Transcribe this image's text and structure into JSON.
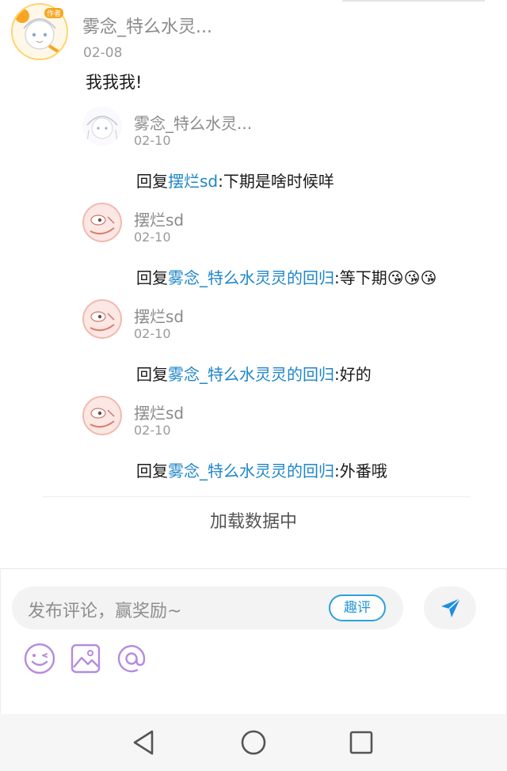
{
  "thread": {
    "main_comment": {
      "author": "雾念_特么水灵...",
      "badge": "作者",
      "date": "02-08",
      "text": "我我我!"
    },
    "replies": [
      {
        "author": "雾念_特么水灵...",
        "date": "02-10",
        "prefix": "回复",
        "target": "摆烂sd",
        "sep": ":",
        "text": "下期是啥时候咩"
      },
      {
        "author": "摆烂sd",
        "date": "02-10",
        "prefix": "回复",
        "target": "雾念_特么水灵灵的回归",
        "sep": ":",
        "text": "等下期😘😘😘"
      },
      {
        "author": "摆烂sd",
        "date": "02-10",
        "prefix": "回复",
        "target": "雾念_特么水灵灵的回归",
        "sep": ":",
        "text": "好的"
      },
      {
        "author": "摆烂sd",
        "date": "02-10",
        "prefix": "回复",
        "target": "雾念_特么水灵灵的回归",
        "sep": ":",
        "text": "外番哦"
      }
    ],
    "loading_text": "加载数据中"
  },
  "composer": {
    "placeholder": "发布评论，赢奖励~",
    "quick_comment_label": "趣评",
    "send_icon": "send-icon",
    "tools": [
      "emoji-icon",
      "image-icon",
      "mention-icon"
    ]
  },
  "navbar": {
    "icons": [
      "back-triangle-icon",
      "home-circle-icon",
      "recents-square-icon"
    ]
  },
  "colors": {
    "link": "#1e86c8",
    "accent": "#2ba0e0",
    "tool_icon": "#b58be0"
  }
}
